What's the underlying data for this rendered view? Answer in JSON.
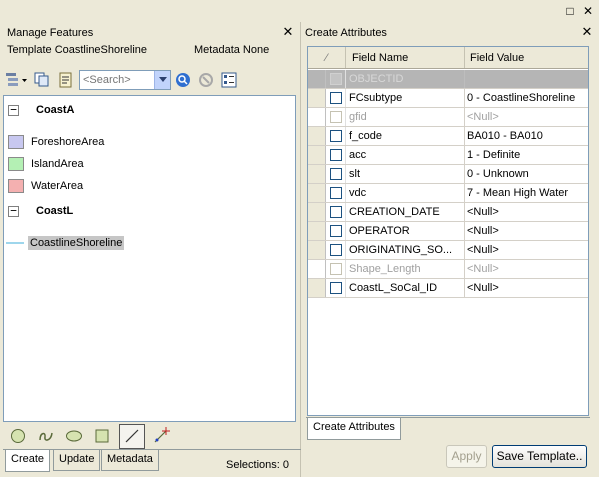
{
  "window": {
    "restore_glyph": "□",
    "close_glyph": "✕"
  },
  "manage_features": {
    "title": "Manage Features",
    "close_glyph": "✕",
    "template_label": "Template CoastlineShoreline",
    "metadata_label": "Metadata None",
    "search_placeholder": "<Search>",
    "groups": [
      {
        "name": "CoastA",
        "expander": "−",
        "items": [
          {
            "label": "ForeshoreArea",
            "color": "#c8c8f0"
          },
          {
            "label": "IslandArea",
            "color": "#b4f0b4"
          },
          {
            "label": "WaterArea",
            "color": "#f4b0b0"
          }
        ]
      },
      {
        "name": "CoastL",
        "expander": "−",
        "items": [
          {
            "label": "CoastlineShoreline",
            "color": "#7ec8e6"
          }
        ]
      }
    ],
    "tabs": [
      "Create",
      "Update",
      "Metadata"
    ],
    "selections": "Selections: 0"
  },
  "create_attributes": {
    "title": "Create Attributes",
    "close_glyph": "✕",
    "header": {
      "sort_glyph": "⁄",
      "field_name": "Field Name",
      "field_value": "Field Value"
    },
    "rows": [
      {
        "name": "OBJECTID",
        "value": "",
        "state": "objectid"
      },
      {
        "name": "FCsubtype",
        "value": "0 - CoastlineShoreline",
        "state": "normal"
      },
      {
        "name": "gfid",
        "value": "<Null>",
        "state": "disabled"
      },
      {
        "name": "f_code",
        "value": "BA010 - BA010",
        "state": "normal"
      },
      {
        "name": "acc",
        "value": "1 - Definite",
        "state": "normal"
      },
      {
        "name": "slt",
        "value": "0 - Unknown",
        "state": "normal"
      },
      {
        "name": "vdc",
        "value": "7 - Mean High Water",
        "state": "normal"
      },
      {
        "name": "CREATION_DATE",
        "value": "<Null>",
        "state": "normal"
      },
      {
        "name": "OPERATOR",
        "value": "<Null>",
        "state": "normal"
      },
      {
        "name": "ORIGINATING_SO...",
        "value": "<Null>",
        "state": "normal"
      },
      {
        "name": "Shape_Length",
        "value": "<Null>",
        "state": "disabled"
      },
      {
        "name": "CoastL_SoCal_ID",
        "value": "<Null>",
        "state": "normal"
      }
    ],
    "tab": "Create Attributes",
    "apply_label": "Apply",
    "save_template_label": "Save Template.."
  }
}
